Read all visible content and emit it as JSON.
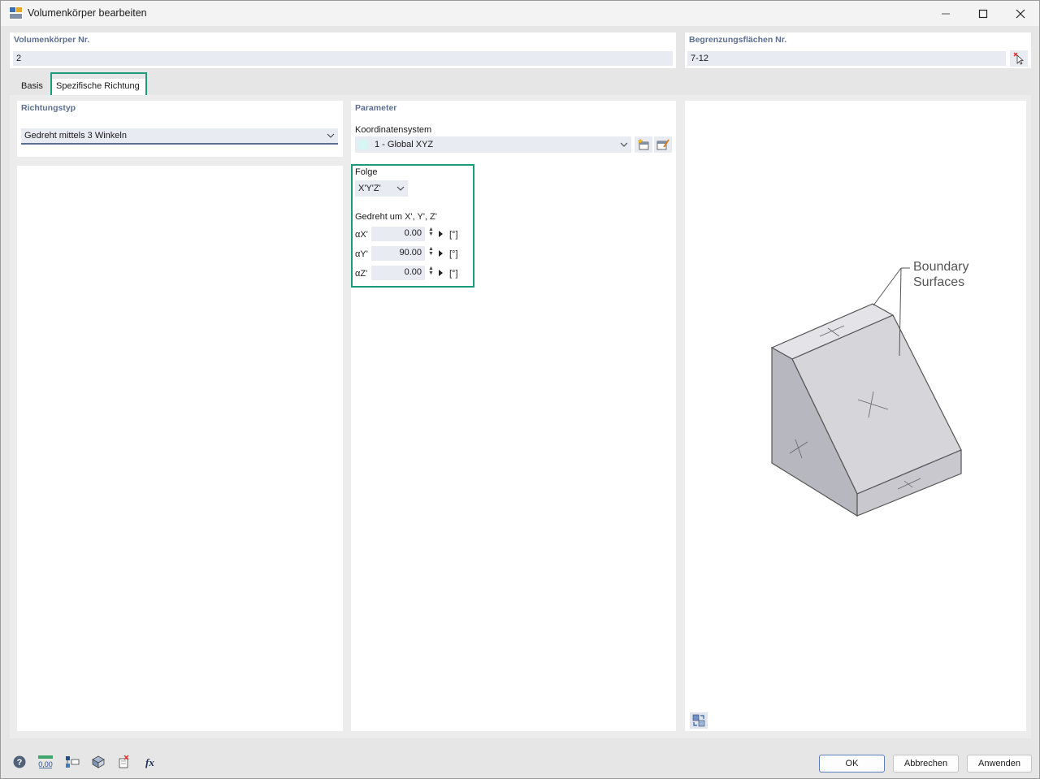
{
  "window": {
    "title": "Volumenkörper bearbeiten"
  },
  "header": {
    "solid_no_label": "Volumenkörper Nr.",
    "solid_no_value": "2",
    "boundary_label": "Begrenzungsflächen Nr.",
    "boundary_value": "7-12"
  },
  "tabs": [
    {
      "label": "Basis"
    },
    {
      "label": "Spezifische Richtung"
    }
  ],
  "direction_type": {
    "title": "Richtungstyp",
    "selected": "Gedreht mittels 3 Winkeln"
  },
  "parameters": {
    "title": "Parameter",
    "coord_system_label": "Koordinatensystem",
    "coord_system_value": "1 - Global XYZ",
    "sequence_label": "Folge",
    "sequence_value": "X'Y'Z'",
    "rotated_label": "Gedreht um X', Y', Z'",
    "angles": [
      {
        "label": "αX'",
        "value": "0.00",
        "unit": "[°]"
      },
      {
        "label": "αY'",
        "value": "90.00",
        "unit": "[°]"
      },
      {
        "label": "αZ'",
        "value": "0.00",
        "unit": "[°]"
      }
    ]
  },
  "illustration": {
    "callout_line1": "Boundary",
    "callout_line2": "Surfaces"
  },
  "footer": {
    "ok": "OK",
    "cancel": "Abbrechen",
    "apply": "Anwenden",
    "units_icon_text": "0,00"
  },
  "colors": {
    "accent_highlight": "#1a9b7c",
    "section_title": "#5d6f91",
    "field_bg": "#e9ebf2"
  }
}
